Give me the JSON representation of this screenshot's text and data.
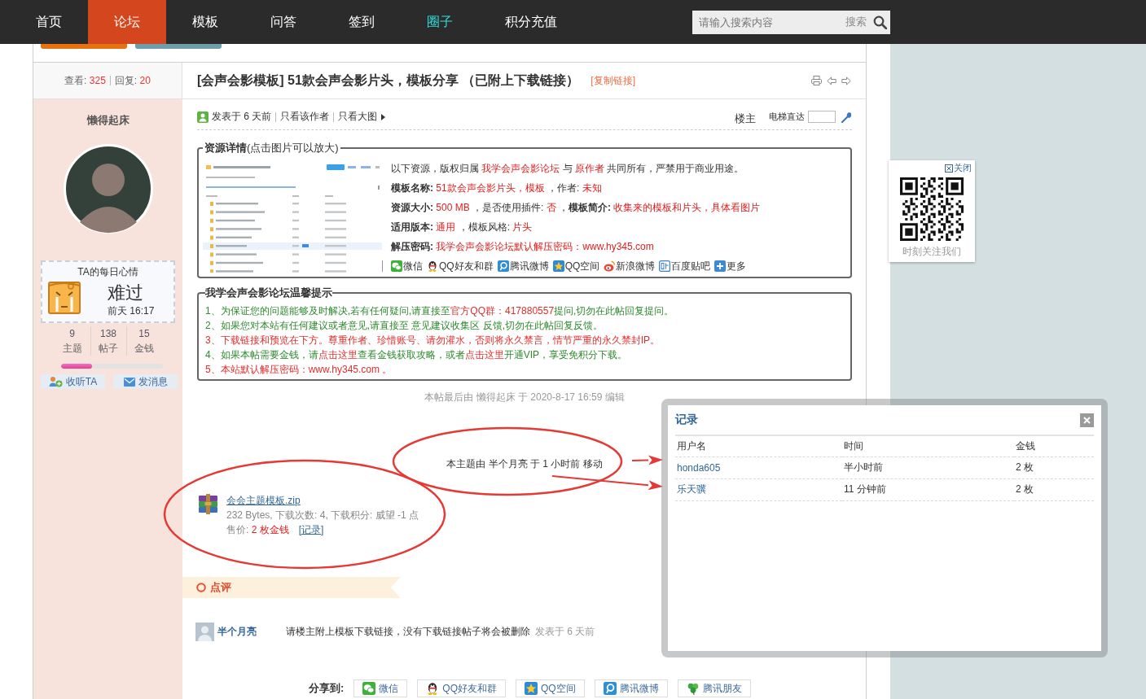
{
  "nav": {
    "items": [
      {
        "label": "首页",
        "selected": false,
        "highlighted": false
      },
      {
        "label": "论坛",
        "selected": true,
        "highlighted": false
      },
      {
        "label": "模板",
        "selected": false,
        "highlighted": false
      },
      {
        "label": "问答",
        "selected": false,
        "highlighted": false
      },
      {
        "label": "签到",
        "selected": false,
        "highlighted": false
      },
      {
        "label": "圈子",
        "selected": false,
        "highlighted": true
      },
      {
        "label": "积分充值",
        "selected": false,
        "highlighted": false
      }
    ],
    "search": {
      "placeholder": "请输入搜索内容",
      "button": "搜索"
    }
  },
  "toolbar": {
    "buttons": [
      {
        "kind": "new_post"
      },
      {
        "kind": "reply"
      }
    ]
  },
  "thread": {
    "views_label": "查看:",
    "views": "325",
    "replies_label": "回复:",
    "replies": "20",
    "title": "[会声会影模板] 51款会声会影片头，模板分享 （已附上下载链接）",
    "copy_link": "[复制链接]"
  },
  "author": {
    "name": "懒得起床",
    "mood": {
      "heading": "TA的每日心情",
      "feeling": "难过",
      "time": "前天 16:17"
    },
    "stats": [
      {
        "value": "9",
        "label": "主题"
      },
      {
        "value": "138",
        "label": "帖子"
      },
      {
        "value": "15",
        "label": "金钱"
      }
    ],
    "progress": {
      "level": 0.3
    },
    "buttons": [
      {
        "label": "收听TA",
        "kind": "follow"
      },
      {
        "label": "发消息",
        "kind": "message"
      }
    ]
  },
  "post": {
    "posted": "发表于 6 天前",
    "links": [
      "只看该作者",
      "只看大图"
    ],
    "floor": "楼主",
    "jump_label": "电梯直达",
    "resource": {
      "legend": "**资源详情**(点击图片可以放大)",
      "lines": [
        [
          {
            "kind": "text",
            "text": "以下资源，版权归属 "
          },
          {
            "kind": "value",
            "text": "我学会声会影论坛"
          },
          {
            "kind": "text",
            "text": " 与 "
          },
          {
            "kind": "value",
            "text": "原作者"
          },
          {
            "kind": "text",
            "text": " 共同所有，严禁用于商业用途。"
          }
        ],
        [
          {
            "kind": "label",
            "text": "模板名称:"
          },
          {
            "kind": "value",
            "text": " 51款会声会影片头，模板"
          },
          {
            "kind": "text",
            "text": " ，作者: "
          },
          {
            "kind": "value",
            "text": "未知"
          }
        ],
        [
          {
            "kind": "label",
            "text": "资源大小:"
          },
          {
            "kind": "value",
            "text": " 500 MB"
          },
          {
            "kind": "text",
            "text": " ，是否使用插件: "
          },
          {
            "kind": "value",
            "text": "否"
          },
          {
            "kind": "text",
            "text": " ，"
          },
          {
            "kind": "label",
            "text": "模板简介:"
          },
          {
            "kind": "value",
            "text": " 收集来的模板和片头，具体看图片"
          }
        ],
        [
          {
            "kind": "label",
            "text": "适用版本:"
          },
          {
            "kind": "value",
            "text": " 通用"
          },
          {
            "kind": "text",
            "text": " ，模板风格: "
          },
          {
            "kind": "value",
            "text": "片头"
          }
        ],
        [
          {
            "kind": "label",
            "text": "解压密码:"
          },
          {
            "kind": "value",
            "text": " 我学会声会影论坛默认解压密码：www.hy345.com"
          }
        ]
      ],
      "share": [
        {
          "label": "微信",
          "kind": "wechat"
        },
        {
          "label": "QQ好友和群",
          "kind": "qq"
        },
        {
          "label": "腾讯微博",
          "kind": "tencent_weibo"
        },
        {
          "label": "QQ空间",
          "kind": "qzone"
        },
        {
          "label": "新浪微博",
          "kind": "sina_weibo"
        },
        {
          "label": "百度贴吧",
          "kind": "tieba"
        },
        {
          "label": "更多",
          "kind": "more"
        }
      ]
    },
    "tips": {
      "legend": "我学会声会影论坛温馨提示",
      "lines": [
        [
          {
            "kind": "text",
            "text": "1、为保证您的问题能够及时解决,若有任何疑问,请直接至"
          },
          {
            "kind": "link",
            "text": "官方QQ群：417880557"
          },
          {
            "kind": "text",
            "text": "提问,切勿在此帖回复提问。"
          }
        ],
        [
          {
            "kind": "text",
            "text": "2、如果您对本站有任何建议或者意见,请直接至 意见建议收集区 反馈,切勿在此帖回复反馈。"
          }
        ],
        [
          {
            "kind": "alert",
            "text": "3、下载链接和预览在下方。尊重作者、珍惜账号、请勿灌水，否则将永久禁言，情节严重的永久禁封IP。"
          }
        ],
        [
          {
            "kind": "text",
            "text": "4、如果本帖需要金钱，请"
          },
          {
            "kind": "link",
            "text": "点击这里"
          },
          {
            "kind": "text",
            "text": "查看金钱获取攻略，或者"
          },
          {
            "kind": "link",
            "text": "点击这里"
          },
          {
            "kind": "text",
            "text": "开通VIP，享受免积分下载。"
          }
        ],
        [
          {
            "kind": "alert",
            "text": "5、本站默认解压密码：www.hy345.com 。"
          }
        ]
      ]
    },
    "edit_note": "本帖最后由 懒得起床 于 2020-8-17 16:59 编辑",
    "moved_note": "本主题由 半个月亮 于 1 小时前 移动",
    "attachment": {
      "file": "会会主题模板.zip",
      "info": "232 Bytes, 下载次数: 4, 下载积分: 威望 -1 点",
      "price_label": "售价:",
      "price": "2 枚金钱",
      "record_link": "[记录]"
    }
  },
  "review": {
    "heading": "点评",
    "comments": [
      {
        "user": "半个月亮",
        "text": "请楼主附上模板下载链接，没有下载链接帖子将会被删除",
        "time": "发表于 6 天前"
      }
    ]
  },
  "share_bar": {
    "label": "分享到:",
    "items": [
      {
        "label": "微信",
        "kind": "wechat"
      },
      {
        "label": "QQ好友和群",
        "kind": "qq"
      },
      {
        "label": "QQ空间",
        "kind": "qzone"
      },
      {
        "label": "腾讯微博",
        "kind": "tencent_weibo"
      },
      {
        "label": "腾讯朋友",
        "kind": "tencent_friends"
      }
    ]
  },
  "record_dialog": {
    "title": "记录",
    "columns": [
      "用户名",
      "时间",
      "金钱"
    ],
    "rows": [
      {
        "user": "honda605",
        "time": "半小时前",
        "amount": "2 枚"
      },
      {
        "user": "乐天骥",
        "time": "11 分钟前",
        "amount": "2 枚"
      }
    ]
  },
  "qr_widget": {
    "close": "关闭",
    "caption": "时刻关注我们"
  },
  "annotations": [
    {
      "kind": "ellipse"
    },
    {
      "kind": "ellipse"
    },
    {
      "kind": "arrow"
    },
    {
      "kind": "arrow"
    }
  ]
}
